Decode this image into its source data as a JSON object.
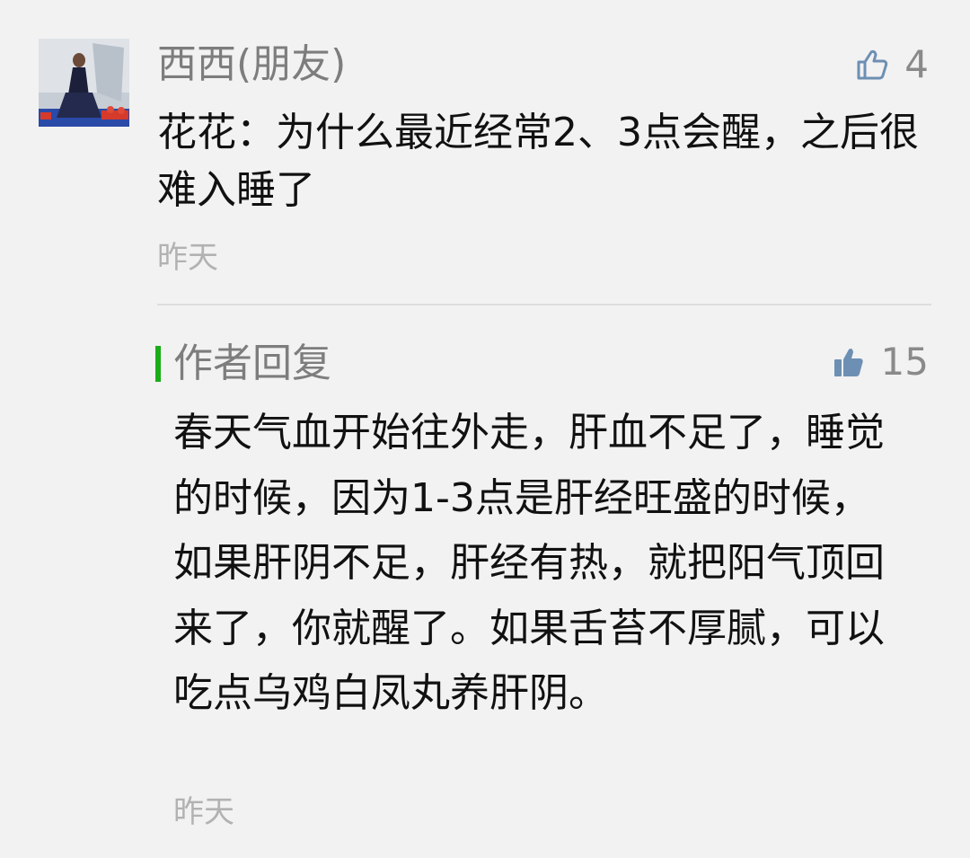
{
  "comment": {
    "author": "西西(朋友)",
    "text": "花花：为什么最近经常2、3点会醒，之后很难入睡了",
    "time": "昨天",
    "likes": "4",
    "like_icon": "thumbs-up-outline-icon"
  },
  "reply": {
    "label": "作者回复",
    "text": "春天气血开始往外走，肝血不足了，睡觉的时候，因为1-3点是肝经旺盛的时候，如果肝阴不足，肝经有热，就把阳气顶回来了，你就醒了。如果舌苔不厚腻，可以吃点乌鸡白凤丸养肝阴。",
    "time": "昨天",
    "likes": "15",
    "like_icon": "thumbs-up-filled-icon"
  },
  "colors": {
    "background": "#f2f2f2",
    "name_gray": "#7d7d7d",
    "time_gray": "#b2b2b2",
    "icon_blue": "#6d8fb3",
    "reply_bar_green": "#1aad19"
  }
}
